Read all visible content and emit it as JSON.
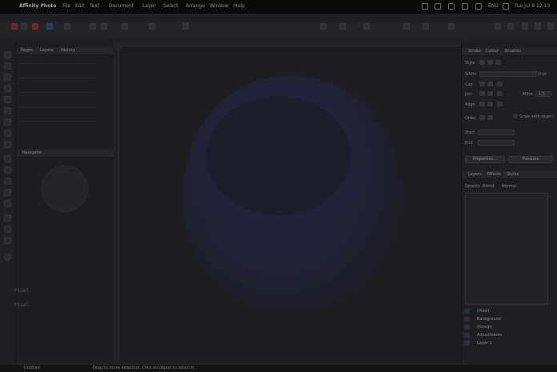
{
  "menubar": {
    "app": "Affinity Photo",
    "items": [
      "File",
      "Edit",
      "Text",
      "Document",
      "Layer",
      "Select",
      "Arrange",
      "Window",
      "Help"
    ],
    "input_indicator": "ENG",
    "clock": "Tue Jul 8  12:13"
  },
  "left_panel": {
    "tabs": [
      "Pages",
      "Layers",
      "History"
    ],
    "navigator_label": "Navigator"
  },
  "right_panel": {
    "tabs": [
      "Stroke",
      "Colour",
      "Brushes"
    ],
    "style_label": "Style",
    "width_label": "Width",
    "width_value": "0 pt",
    "cap_label": "Cap",
    "join_label": "Join",
    "mitre_label": "Mitre",
    "mitre_value": "1.5",
    "align_label": "Align",
    "order_label": "Order",
    "scale_label": "Scale with object",
    "start_label": "Start",
    "end_label": "End",
    "properties_button": "Properties...",
    "pressure_button": "Pressure",
    "layers_tabs": [
      "Layers",
      "Effects",
      "Styles"
    ],
    "opacity_label": "Opacity",
    "blend_label": "Blend",
    "normal_label": "Normal",
    "layers": [
      {
        "name": "(Pixel)"
      },
      {
        "name": "Background"
      },
      {
        "name": "(Group)"
      },
      {
        "name": "Adjustments"
      },
      {
        "name": "Layer 1"
      }
    ]
  },
  "ghost_text": [
    "Pixel",
    "Pixel"
  ],
  "status": {
    "doc": "Untitled",
    "hint": "Drag to move selection. Click an object to select it."
  }
}
